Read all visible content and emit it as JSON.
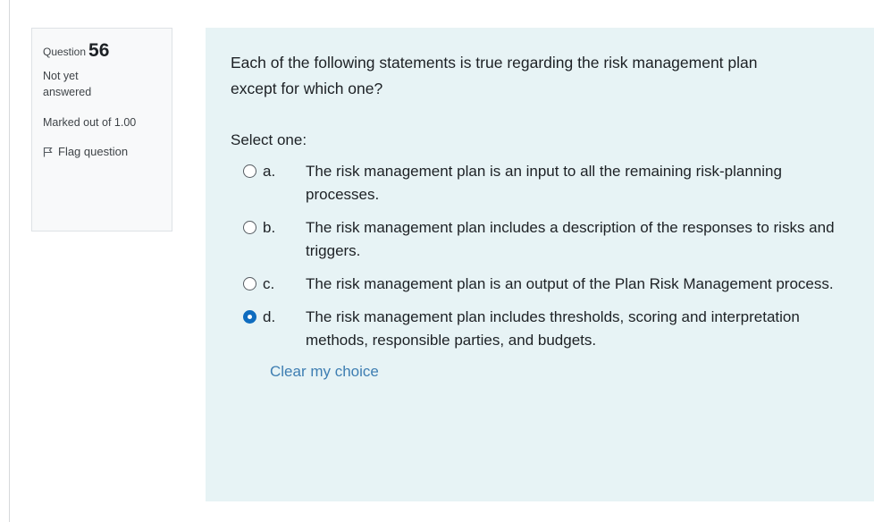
{
  "info": {
    "question_label": "Question",
    "question_number": "56",
    "state": "Not yet answered",
    "grade": "Marked out of 1.00",
    "flag_label": "Flag question"
  },
  "question": {
    "text": "Each of the following statements is true regarding the risk management plan except for which one?",
    "prompt": "Select one:",
    "selected": "d",
    "answers": [
      {
        "letter": "a.",
        "text": "The risk management plan is an input to all the remaining risk-planning processes."
      },
      {
        "letter": "b.",
        "text": "The risk management plan includes a description of the responses to risks and triggers."
      },
      {
        "letter": "c.",
        "text": "The risk management plan is an output of the Plan Risk Management process."
      },
      {
        "letter": "d.",
        "text": "The risk management plan includes thresholds, scoring and interpretation methods, responsible parties, and budgets."
      }
    ],
    "clear_label": "Clear my choice"
  },
  "colors": {
    "formulation_bg": "#e7f3f5",
    "accent": "#0f6cbf",
    "link": "#3e7eb2"
  },
  "icons": {
    "flag": "flag-icon",
    "radio": "radio-button-icon"
  }
}
